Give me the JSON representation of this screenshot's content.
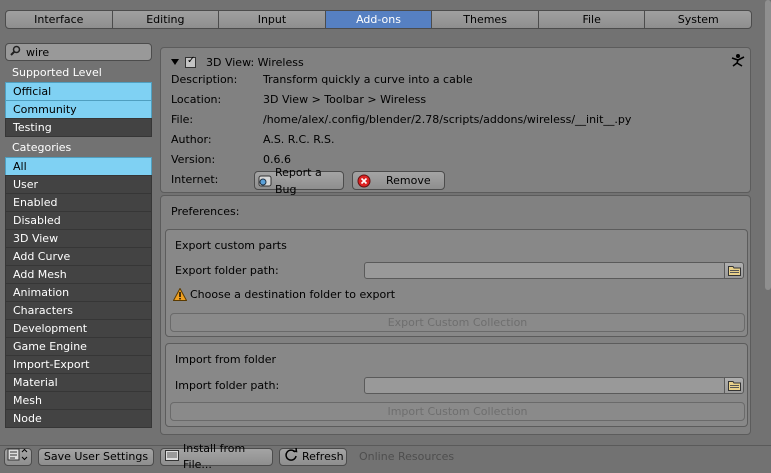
{
  "tabs": [
    "Interface",
    "Editing",
    "Input",
    "Add-ons",
    "Themes",
    "File",
    "System"
  ],
  "active_tab": "Add-ons",
  "search": {
    "value": "wire"
  },
  "sidebar": {
    "supported_label": "Supported Level",
    "supported": [
      {
        "label": "Official",
        "selected": true
      },
      {
        "label": "Community",
        "selected": true
      },
      {
        "label": "Testing",
        "selected": false
      }
    ],
    "categories_label": "Categories",
    "categories": [
      {
        "label": "All",
        "selected": true
      },
      {
        "label": "User",
        "selected": false
      },
      {
        "label": "Enabled",
        "selected": false
      },
      {
        "label": "Disabled",
        "selected": false
      },
      {
        "label": "3D View",
        "selected": false
      },
      {
        "label": "Add Curve",
        "selected": false
      },
      {
        "label": "Add Mesh",
        "selected": false
      },
      {
        "label": "Animation",
        "selected": false
      },
      {
        "label": "Characters",
        "selected": false
      },
      {
        "label": "Development",
        "selected": false
      },
      {
        "label": "Game Engine",
        "selected": false
      },
      {
        "label": "Import-Export",
        "selected": false
      },
      {
        "label": "Material",
        "selected": false
      },
      {
        "label": "Mesh",
        "selected": false
      },
      {
        "label": "Node",
        "selected": false
      }
    ]
  },
  "addon": {
    "title": "3D View: Wireless",
    "enabled": true,
    "description_label": "Description:",
    "description": "Transform quickly a curve into a cable",
    "location_label": "Location:",
    "location": "3D View > Toolbar > Wireless",
    "file_label": "File:",
    "file": "/home/alex/.config/blender/2.78/scripts/addons/wireless/__init__.py",
    "author_label": "Author:",
    "author": "A.S. R.C. R.S.",
    "version_label": "Version:",
    "version": "0.6.6",
    "internet_label": "Internet:",
    "report_bug": "Report a Bug",
    "remove": "Remove"
  },
  "preferences": {
    "title": "Preferences:",
    "export": {
      "title": "Export custom parts",
      "path_label": "Export folder path:",
      "path_value": "",
      "warning": "Choose a destination folder to export",
      "button": "Export Custom Collection"
    },
    "import": {
      "title": "Import from folder",
      "path_label": "Import folder path:",
      "path_value": "",
      "button": "Import Custom Collection"
    }
  },
  "bottombar": {
    "save": "Save User Settings",
    "install": "Install from File...",
    "refresh": "Refresh",
    "online": "Online Resources"
  },
  "colors": {
    "background": "#727272",
    "selected": "#7fd1f3",
    "active_tab": "#5680c2",
    "sidebar_item": "#434343"
  }
}
